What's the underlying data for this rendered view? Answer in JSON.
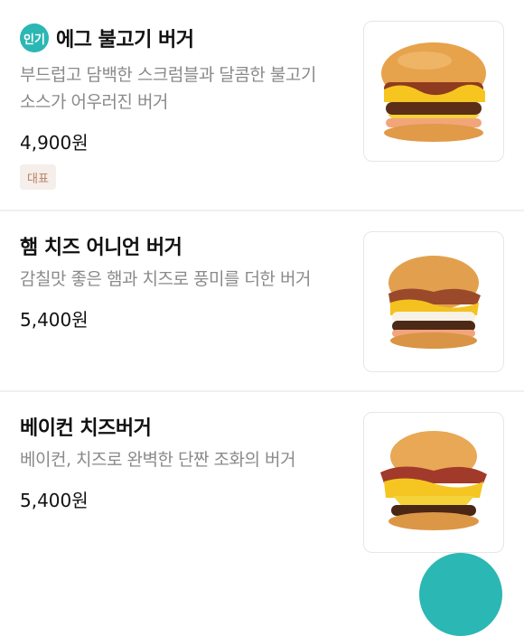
{
  "menu": [
    {
      "popular_badge": "인기",
      "name": "에그 불고기 버거",
      "description_lines": [
        "부드럽고 담백한 스크럼블과 달콤한 불고기",
        "소스가 어우러진 버거"
      ],
      "price": "4,900원",
      "tag": "대표",
      "image": "egg-bulgogi-burger"
    },
    {
      "name": "햄 치즈 어니언 버거",
      "description_lines": [
        "감칠맛 좋은 햄과 치즈로 풍미를 더한 버거"
      ],
      "price": "5,400원",
      "image": "ham-cheese-onion-burger"
    },
    {
      "name": "베이컨 치즈버거",
      "description_lines": [
        "베이컨, 치즈로 완벽한 단짠 조화의 버거"
      ],
      "price": "5,400원",
      "image": "bacon-cheese-burger"
    }
  ],
  "colors": {
    "accent": "#2bb7b3",
    "tag_bg": "#f5eeea",
    "tag_text": "#b98162",
    "description": "#8a8a8a"
  }
}
